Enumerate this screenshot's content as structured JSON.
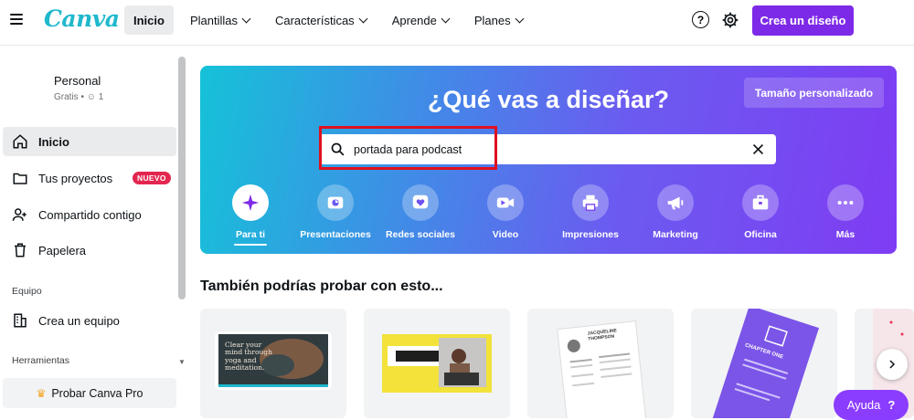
{
  "header": {
    "logo": "Canva",
    "nav": [
      {
        "label": "Inicio",
        "active": true,
        "dropdown": false
      },
      {
        "label": "Plantillas",
        "active": false,
        "dropdown": true
      },
      {
        "label": "Características",
        "active": false,
        "dropdown": true
      },
      {
        "label": "Aprende",
        "active": false,
        "dropdown": true
      },
      {
        "label": "Planes",
        "active": false,
        "dropdown": true
      }
    ],
    "help_icon": "?",
    "create_label": "Crea un diseño",
    "accent": "#7d2ae8"
  },
  "sidebar": {
    "account_name": "Personal",
    "account_plan": "Gratis",
    "account_members": "1",
    "items": [
      {
        "label": "Inicio",
        "icon": "home-icon",
        "active": true
      },
      {
        "label": "Tus proyectos",
        "icon": "folder-icon",
        "badge": "NUEVO"
      },
      {
        "label": "Compartido contigo",
        "icon": "shared-users-icon"
      },
      {
        "label": "Papelera",
        "icon": "trash-icon"
      }
    ],
    "team_heading": "Equipo",
    "team_item": "Crea un equipo",
    "tools_heading": "Herramientas",
    "pro_label": "Probar Canva Pro"
  },
  "hero": {
    "title": "¿Qué vas a diseñar?",
    "custom_size": "Tamaño personalizado",
    "search_value": "portada para podcast",
    "categories": [
      {
        "label": "Para ti",
        "icon": "sparkle-icon",
        "active": true
      },
      {
        "label": "Presentaciones",
        "icon": "presentation-icon"
      },
      {
        "label": "Redes sociales",
        "icon": "heart-icon"
      },
      {
        "label": "Video",
        "icon": "video-camera-icon"
      },
      {
        "label": "Impresiones",
        "icon": "printer-icon"
      },
      {
        "label": "Marketing",
        "icon": "megaphone-icon"
      },
      {
        "label": "Oficina",
        "icon": "briefcase-icon"
      },
      {
        "label": "Más",
        "icon": "more-dots-icon"
      }
    ]
  },
  "suggestions": {
    "title": "También podrías probar con esto...",
    "card1_text": "Clear your mind through yoga and meditation.",
    "card3_name": "JACQUELINE THOMPSON",
    "card4_text": "CHAPTER ONE"
  },
  "help_label": "Ayuda",
  "help_mark": "?"
}
